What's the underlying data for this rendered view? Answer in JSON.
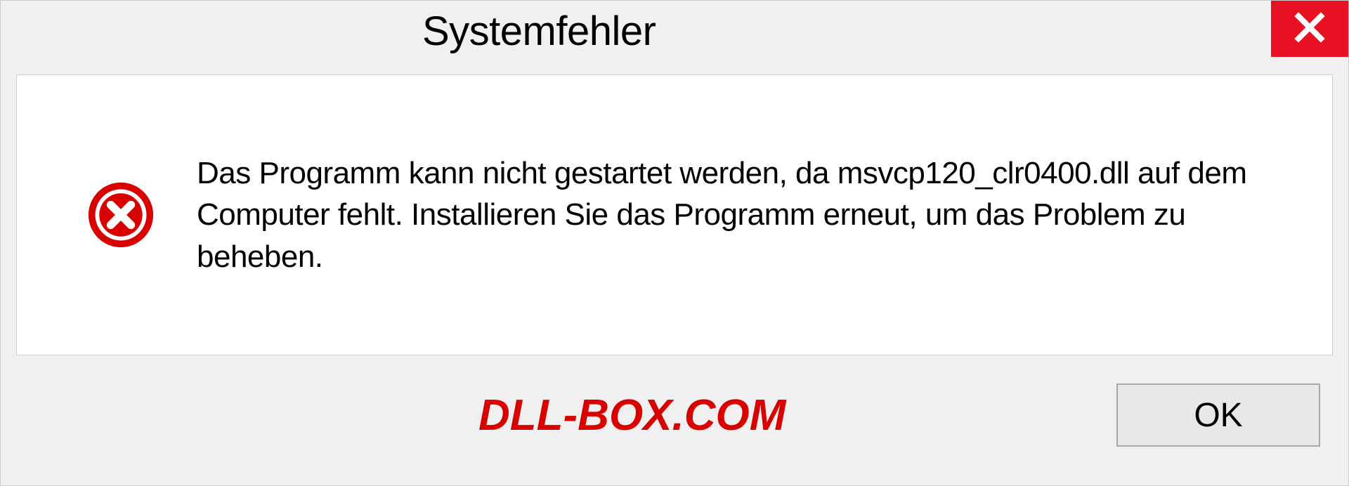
{
  "dialog": {
    "title": "Systemfehler",
    "message": "Das Programm kann nicht gestartet werden, da msvcp120_clr0400.dll auf dem Computer fehlt. Installieren Sie das Programm erneut, um das Problem zu beheben.",
    "ok_label": "OK"
  },
  "watermark": "DLL-BOX.COM",
  "icons": {
    "close": "close-icon",
    "error": "error-icon"
  },
  "colors": {
    "close_bg": "#e81123",
    "error_red": "#d90000",
    "watermark_red": "#d90000"
  }
}
